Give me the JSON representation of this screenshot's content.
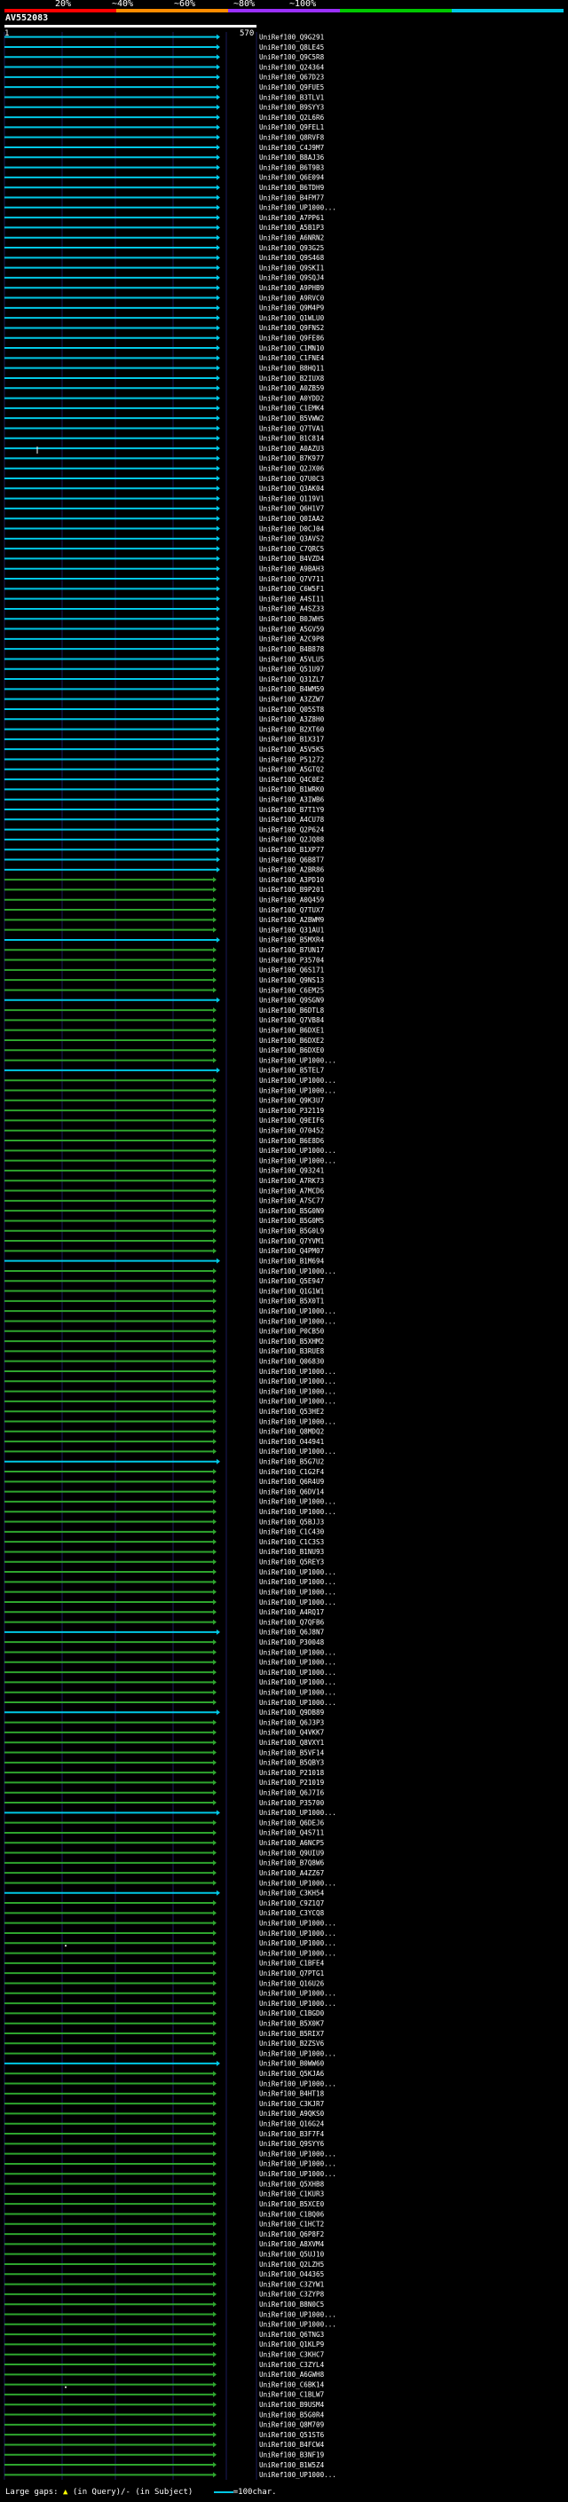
{
  "scale": {
    "labels": [
      "20%",
      "~40%",
      "~60%",
      "~80%",
      "~100%"
    ],
    "colors": [
      "#ff0000",
      "#ff8c00",
      "#9b30ff",
      "#00c800",
      "#00c8e6"
    ]
  },
  "query": {
    "name": "AV552083",
    "range_start": "1",
    "range_end": "570"
  },
  "hit_colors": {
    "blue": "#00c8e6",
    "green": "#2ea52e",
    "dark": "#1a6b1a",
    "cursor": "#ffffff"
  },
  "hits": [
    {
      "label": "UniRef100_Q9G291",
      "c": "b"
    },
    {
      "label": "UniRef100_Q8LE45",
      "c": "b"
    },
    {
      "label": "UniRef100_Q9C5R8",
      "c": "b"
    },
    {
      "label": "UniRef100_Q24364",
      "c": "b"
    },
    {
      "label": "UniRef100_Q67D23",
      "c": "b"
    },
    {
      "label": "UniRef100_Q9FUE5",
      "c": "b"
    },
    {
      "label": "UniRef100_B3TLV1",
      "c": "b"
    },
    {
      "label": "UniRef100_B9SYY3",
      "c": "b"
    },
    {
      "label": "UniRef100_Q2L6R6",
      "c": "b"
    },
    {
      "label": "UniRef100_Q9FEL1",
      "c": "b"
    },
    {
      "label": "UniRef100_Q8RVF8",
      "c": "b"
    },
    {
      "label": "UniRef100_C4J9M7",
      "c": "b"
    },
    {
      "label": "UniRef100_B8AJ36",
      "c": "b"
    },
    {
      "label": "UniRef100_B6T9B3",
      "c": "b"
    },
    {
      "label": "UniRef100_Q6E094",
      "c": "b"
    },
    {
      "label": "UniRef100_B6TDH9",
      "c": "b"
    },
    {
      "label": "UniRef100_B4FM77",
      "c": "b"
    },
    {
      "label": "UniRef100_UP1000...",
      "c": "b"
    },
    {
      "label": "UniRef100_A7PP61",
      "c": "b"
    },
    {
      "label": "UniRef100_A5B1P3",
      "c": "b"
    },
    {
      "label": "UniRef100_A6NRN2",
      "c": "b"
    },
    {
      "label": "UniRef100_Q93G25",
      "c": "b"
    },
    {
      "label": "UniRef100_Q9S468",
      "c": "b"
    },
    {
      "label": "UniRef100_Q9SKI1",
      "c": "b"
    },
    {
      "label": "UniRef100_Q9SQJ4",
      "c": "b"
    },
    {
      "label": "UniRef100_A9PHB9",
      "c": "b"
    },
    {
      "label": "UniRef100_A9RVC0",
      "c": "b"
    },
    {
      "label": "UniRef100_Q9M4P9",
      "c": "b"
    },
    {
      "label": "UniRef100_Q1WLU0",
      "c": "b"
    },
    {
      "label": "UniRef100_Q9FNS2",
      "c": "b"
    },
    {
      "label": "UniRef100_Q9FE86",
      "c": "b"
    },
    {
      "label": "UniRef100_C1MN10",
      "c": "b"
    },
    {
      "label": "UniRef100_C1FNE4",
      "c": "b"
    },
    {
      "label": "UniRef100_B8HQ11",
      "c": "b"
    },
    {
      "label": "UniRef100_B2IUX8",
      "c": "b"
    },
    {
      "label": "UniRef100_A0ZB59",
      "c": "b"
    },
    {
      "label": "UniRef100_A0YDD2",
      "c": "b"
    },
    {
      "label": "UniRef100_C1EMK4",
      "c": "b"
    },
    {
      "label": "UniRef100_B5VWW2",
      "c": "b"
    },
    {
      "label": "UniRef100_Q7TVA1",
      "c": "b"
    },
    {
      "label": "UniRef100_B1C814",
      "c": "b"
    },
    {
      "label": "UniRef100_A0AZU3",
      "c": "b",
      "gap": true
    },
    {
      "label": "UniRef100_B7K977",
      "c": "b"
    },
    {
      "label": "UniRef100_Q2JX06",
      "c": "b"
    },
    {
      "label": "UniRef100_Q7U0C3",
      "c": "b"
    },
    {
      "label": "UniRef100_Q3AK04",
      "c": "b"
    },
    {
      "label": "UniRef100_Q119V1",
      "c": "b"
    },
    {
      "label": "UniRef100_Q6H1V7",
      "c": "b"
    },
    {
      "label": "UniRef100_Q0IAA2",
      "c": "b"
    },
    {
      "label": "UniRef100_D0CJ04",
      "c": "b"
    },
    {
      "label": "UniRef100_Q3AVS2",
      "c": "b"
    },
    {
      "label": "UniRef100_C7QRC5",
      "c": "b"
    },
    {
      "label": "UniRef100_B4VZD4",
      "c": "b"
    },
    {
      "label": "UniRef100_A9BAH3",
      "c": "b"
    },
    {
      "label": "UniRef100_Q7V711",
      "c": "b"
    },
    {
      "label": "UniRef100_C6W5F1",
      "c": "b"
    },
    {
      "label": "UniRef100_A4SI11",
      "c": "b"
    },
    {
      "label": "UniRef100_A4SZ33",
      "c": "b"
    },
    {
      "label": "UniRef100_B0JWH5",
      "c": "b"
    },
    {
      "label": "UniRef100_A5GV59",
      "c": "b"
    },
    {
      "label": "UniRef100_A2C9P8",
      "c": "b"
    },
    {
      "label": "UniRef100_B4B878",
      "c": "b"
    },
    {
      "label": "UniRef100_A5VLU5",
      "c": "b"
    },
    {
      "label": "UniRef100_Q51U97",
      "c": "b"
    },
    {
      "label": "UniRef100_Q31ZL7",
      "c": "b"
    },
    {
      "label": "UniRef100_B4WM59",
      "c": "b"
    },
    {
      "label": "UniRef100_A3ZZW7",
      "c": "b"
    },
    {
      "label": "UniRef100_Q05ST8",
      "c": "b"
    },
    {
      "label": "UniRef100_A3Z8H0",
      "c": "b"
    },
    {
      "label": "UniRef100_B2XT60",
      "c": "b"
    },
    {
      "label": "UniRef100_B1X317",
      "c": "b"
    },
    {
      "label": "UniRef100_A5V5K5",
      "c": "b"
    },
    {
      "label": "UniRef100_P51272",
      "c": "b"
    },
    {
      "label": "UniRef100_A5GTQ2",
      "c": "b"
    },
    {
      "label": "UniRef100_Q4C0E2",
      "c": "b"
    },
    {
      "label": "UniRef100_B1WRK0",
      "c": "b"
    },
    {
      "label": "UniRef100_A3IWB6",
      "c": "b"
    },
    {
      "label": "UniRef100_B7T1Y9",
      "c": "b"
    },
    {
      "label": "UniRef100_A4CU78",
      "c": "b"
    },
    {
      "label": "UniRef100_Q2P624",
      "c": "b"
    },
    {
      "label": "UniRef100_Q2JQ88",
      "c": "b"
    },
    {
      "label": "UniRef100_B1XP77",
      "c": "b"
    },
    {
      "label": "UniRef100_Q6B8T7",
      "c": "b"
    },
    {
      "label": "UniRef100_A2BR86",
      "c": "b"
    },
    {
      "label": "UniRef100_A3PD10",
      "c": "g"
    },
    {
      "label": "UniRef100_B9P201",
      "c": "g"
    },
    {
      "label": "UniRef100_A0Q459",
      "c": "g"
    },
    {
      "label": "UniRef100_Q7TUX7",
      "c": "g"
    },
    {
      "label": "UniRef100_A2BWM9",
      "c": "g"
    },
    {
      "label": "UniRef100_Q31AU1",
      "c": "g"
    },
    {
      "label": "UniRef100_B5MXR4",
      "c": "b"
    },
    {
      "label": "UniRef100_B7UN17",
      "c": "g"
    },
    {
      "label": "UniRef100_P35704",
      "c": "g"
    },
    {
      "label": "UniRef100_Q6S171",
      "c": "g"
    },
    {
      "label": "UniRef100_Q9NS13",
      "c": "g"
    },
    {
      "label": "UniRef100_C6EM25",
      "c": "g"
    },
    {
      "label": "UniRef100_Q9SGN9",
      "c": "b"
    },
    {
      "label": "UniRef100_B6DTL8",
      "c": "g"
    },
    {
      "label": "UniRef100_Q7VB84",
      "c": "g"
    },
    {
      "label": "UniRef100_B6DXE1",
      "c": "g"
    },
    {
      "label": "UniRef100_B6DXE2",
      "c": "g"
    },
    {
      "label": "UniRef100_B6DXE0",
      "c": "g"
    },
    {
      "label": "UniRef100_UP1000...",
      "c": "g"
    },
    {
      "label": "UniRef100_B5TEL7",
      "c": "b"
    },
    {
      "label": "UniRef100_UP1000...",
      "c": "g"
    },
    {
      "label": "UniRef100_UP1000...",
      "c": "g"
    },
    {
      "label": "UniRef100_Q9K3U7",
      "c": "g"
    },
    {
      "label": "UniRef100_P32119",
      "c": "g"
    },
    {
      "label": "UniRef100_Q9EIF6",
      "c": "g"
    },
    {
      "label": "UniRef100_O70452",
      "c": "g"
    },
    {
      "label": "UniRef100_B6E8D6",
      "c": "g"
    },
    {
      "label": "UniRef100_UP1000...",
      "c": "g"
    },
    {
      "label": "UniRef100_UP1000...",
      "c": "g"
    },
    {
      "label": "UniRef100_Q93241",
      "c": "g"
    },
    {
      "label": "UniRef100_A7RK73",
      "c": "g"
    },
    {
      "label": "UniRef100_A7MCD6",
      "c": "g"
    },
    {
      "label": "UniRef100_A7SC77",
      "c": "g"
    },
    {
      "label": "UniRef100_B5G0N9",
      "c": "g"
    },
    {
      "label": "UniRef100_B5G0M5",
      "c": "g"
    },
    {
      "label": "UniRef100_B5G0L9",
      "c": "g"
    },
    {
      "label": "UniRef100_Q7YVM1",
      "c": "g"
    },
    {
      "label": "UniRef100_Q4PM07",
      "c": "g"
    },
    {
      "label": "UniRef100_B1M694",
      "c": "b"
    },
    {
      "label": "UniRef100_UP1000...",
      "c": "g"
    },
    {
      "label": "UniRef100_Q5E947",
      "c": "g"
    },
    {
      "label": "UniRef100_Q1G1W1",
      "c": "g"
    },
    {
      "label": "UniRef100_B5X0T1",
      "c": "g"
    },
    {
      "label": "UniRef100_UP1000...",
      "c": "g"
    },
    {
      "label": "UniRef100_UP1000...",
      "c": "g"
    },
    {
      "label": "UniRef100_P0CB50",
      "c": "g"
    },
    {
      "label": "UniRef100_B5XHM2",
      "c": "g"
    },
    {
      "label": "UniRef100_B3RUE8",
      "c": "g"
    },
    {
      "label": "UniRef100_Q06830",
      "c": "g"
    },
    {
      "label": "UniRef100_UP1000...",
      "c": "g"
    },
    {
      "label": "UniRef100_UP1000...",
      "c": "g"
    },
    {
      "label": "UniRef100_UP1000...",
      "c": "g"
    },
    {
      "label": "UniRef100_UP1000...",
      "c": "g"
    },
    {
      "label": "UniRef100_Q53HE2",
      "c": "g"
    },
    {
      "label": "UniRef100_UP1000...",
      "c": "g"
    },
    {
      "label": "UniRef100_Q8MDQ2",
      "c": "g"
    },
    {
      "label": "UniRef100_O44941",
      "c": "g"
    },
    {
      "label": "UniRef100_UP1000...",
      "c": "g"
    },
    {
      "label": "UniRef100_B5G7U2",
      "c": "b"
    },
    {
      "label": "UniRef100_C1G2F4",
      "c": "g"
    },
    {
      "label": "UniRef100_Q6R4U9",
      "c": "g"
    },
    {
      "label": "UniRef100_Q6DV14",
      "c": "g"
    },
    {
      "label": "UniRef100_UP1000...",
      "c": "g"
    },
    {
      "label": "UniRef100_UP1000...",
      "c": "g"
    },
    {
      "label": "UniRef100_Q5BJJ3",
      "c": "g"
    },
    {
      "label": "UniRef100_C1C430",
      "c": "g"
    },
    {
      "label": "UniRef100_C1C3S3",
      "c": "g"
    },
    {
      "label": "UniRef100_B1NU93",
      "c": "g"
    },
    {
      "label": "UniRef100_Q5REY3",
      "c": "g"
    },
    {
      "label": "UniRef100_UP1000...",
      "c": "g"
    },
    {
      "label": "UniRef100_UP1000...",
      "c": "g"
    },
    {
      "label": "UniRef100_UP1000...",
      "c": "g"
    },
    {
      "label": "UniRef100_UP1000...",
      "c": "g"
    },
    {
      "label": "UniRef100_A4RQ17",
      "c": "g"
    },
    {
      "label": "UniRef100_Q7QFB6",
      "c": "g"
    },
    {
      "label": "UniRef100_Q6J8N7",
      "c": "b"
    },
    {
      "label": "UniRef100_P30048",
      "c": "g"
    },
    {
      "label": "UniRef100_UP1000...",
      "c": "g"
    },
    {
      "label": "UniRef100_UP1000...",
      "c": "g"
    },
    {
      "label": "UniRef100_UP1000...",
      "c": "g"
    },
    {
      "label": "UniRef100_UP1000...",
      "c": "g"
    },
    {
      "label": "UniRef100_UP1000...",
      "c": "g"
    },
    {
      "label": "UniRef100_UP1000...",
      "c": "g"
    },
    {
      "label": "UniRef100_Q9DB89",
      "c": "b"
    },
    {
      "label": "UniRef100_Q6J3P3",
      "c": "g"
    },
    {
      "label": "UniRef100_Q4VKK7",
      "c": "g"
    },
    {
      "label": "UniRef100_Q8VXY1",
      "c": "g"
    },
    {
      "label": "UniRef100_B5VF14",
      "c": "g"
    },
    {
      "label": "UniRef100_B5QBY3",
      "c": "g"
    },
    {
      "label": "UniRef100_P21018",
      "c": "g"
    },
    {
      "label": "UniRef100_P21019",
      "c": "g"
    },
    {
      "label": "UniRef100_Q6J7I6",
      "c": "g"
    },
    {
      "label": "UniRef100_P35700",
      "c": "g"
    },
    {
      "label": "UniRef100_UP1000...",
      "c": "b"
    },
    {
      "label": "UniRef100_Q6DEJ6",
      "c": "g"
    },
    {
      "label": "UniRef100_Q4S711",
      "c": "g"
    },
    {
      "label": "UniRef100_A6NCP5",
      "c": "g"
    },
    {
      "label": "UniRef100_Q9UIU9",
      "c": "g"
    },
    {
      "label": "UniRef100_B7Q8W6",
      "c": "g"
    },
    {
      "label": "UniRef100_A4ZZ67",
      "c": "g"
    },
    {
      "label": "UniRef100_UP1000...",
      "c": "g"
    },
    {
      "label": "UniRef100_C3KH54",
      "c": "b"
    },
    {
      "label": "UniRef100_C9Z1Q7",
      "c": "g"
    },
    {
      "label": "UniRef100_C3YCQ8",
      "c": "g"
    },
    {
      "label": "UniRef100_UP1000...",
      "c": "g"
    },
    {
      "label": "UniRef100_UP1000...",
      "c": "g"
    },
    {
      "label": "UniRef100_UP1000...",
      "c": "g",
      "dot": true
    },
    {
      "label": "UniRef100_UP1000...",
      "c": "g"
    },
    {
      "label": "UniRef100_C1BFE4",
      "c": "g"
    },
    {
      "label": "UniRef100_Q7PTG1",
      "c": "g"
    },
    {
      "label": "UniRef100_Q16U26",
      "c": "g"
    },
    {
      "label": "UniRef100_UP1000...",
      "c": "g"
    },
    {
      "label": "UniRef100_UP1000...",
      "c": "g"
    },
    {
      "label": "UniRef100_C1BGD0",
      "c": "g"
    },
    {
      "label": "UniRef100_B5X0K7",
      "c": "g"
    },
    {
      "label": "UniRef100_B5RIX7",
      "c": "g"
    },
    {
      "label": "UniRef100_B2ZSV6",
      "c": "g"
    },
    {
      "label": "UniRef100_UP1000...",
      "c": "g"
    },
    {
      "label": "UniRef100_B0WW60",
      "c": "b"
    },
    {
      "label": "UniRef100_Q5KJA6",
      "c": "g"
    },
    {
      "label": "UniRef100_UP1000...",
      "c": "g"
    },
    {
      "label": "UniRef100_B4HT18",
      "c": "g"
    },
    {
      "label": "UniRef100_C3KJR7",
      "c": "g"
    },
    {
      "label": "UniRef100_A9QKS0",
      "c": "g"
    },
    {
      "label": "UniRef100_Q16G24",
      "c": "g"
    },
    {
      "label": "UniRef100_B3F7F4",
      "c": "g"
    },
    {
      "label": "UniRef100_Q9SYY6",
      "c": "g"
    },
    {
      "label": "UniRef100_UP1000...",
      "c": "g"
    },
    {
      "label": "UniRef100_UP1000...",
      "c": "g"
    },
    {
      "label": "UniRef100_UP1000...",
      "c": "g"
    },
    {
      "label": "UniRef100_Q5XHB8",
      "c": "g"
    },
    {
      "label": "UniRef100_C1KUR3",
      "c": "g"
    },
    {
      "label": "UniRef100_B5XCE0",
      "c": "g"
    },
    {
      "label": "UniRef100_C1BQ06",
      "c": "g"
    },
    {
      "label": "UniRef100_C1HCT2",
      "c": "g"
    },
    {
      "label": "UniRef100_Q6P8F2",
      "c": "g"
    },
    {
      "label": "UniRef100_A8XVM4",
      "c": "g"
    },
    {
      "label": "UniRef100_Q5UJ10",
      "c": "g"
    },
    {
      "label": "UniRef100_Q2LZH5",
      "c": "g"
    },
    {
      "label": "UniRef100_O44365",
      "c": "g"
    },
    {
      "label": "UniRef100_C3ZYW1",
      "c": "g"
    },
    {
      "label": "UniRef100_C3ZYP8",
      "c": "g"
    },
    {
      "label": "UniRef100_B8N0C5",
      "c": "g"
    },
    {
      "label": "UniRef100_UP1000...",
      "c": "g"
    },
    {
      "label": "UniRef100_UP1000...",
      "c": "g"
    },
    {
      "label": "UniRef100_Q6TNG3",
      "c": "g"
    },
    {
      "label": "UniRef100_Q1KLP9",
      "c": "g"
    },
    {
      "label": "UniRef100_C3KHC7",
      "c": "g"
    },
    {
      "label": "UniRef100_C3ZYL4",
      "c": "g"
    },
    {
      "label": "UniRef100_A6GWH8",
      "c": "g"
    },
    {
      "label": "UniRef100_C6BK14",
      "c": "g",
      "dot": true
    },
    {
      "label": "UniRef100_C1BLW7",
      "c": "g"
    },
    {
      "label": "UniRef100_B9USM4",
      "c": "g"
    },
    {
      "label": "UniRef100_B5G0R4",
      "c": "g"
    },
    {
      "label": "UniRef100_Q8M709",
      "c": "g"
    },
    {
      "label": "UniRef100_Q51ST6",
      "c": "g"
    },
    {
      "label": "UniRef100_B4FCW4",
      "c": "g"
    },
    {
      "label": "UniRef100_B3NF19",
      "c": "g"
    },
    {
      "label": "UniRef100_B1W5Z4",
      "c": "g"
    },
    {
      "label": "UniRef100_UP1000...",
      "c": "g"
    }
  ],
  "footer": {
    "gaps_prefix": "Large gaps:",
    "in_query": "(in Query)",
    "separator": "/",
    "in_subject": "- (in Subject)",
    "scale_note": "=100char."
  }
}
